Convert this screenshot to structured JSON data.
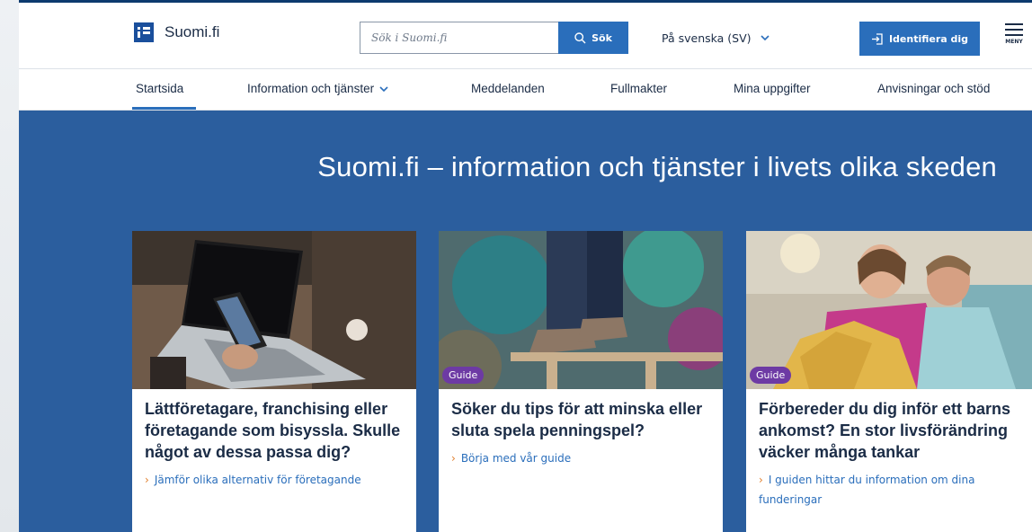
{
  "header": {
    "logo_text": "Suomi.fi",
    "search_placeholder": "Sök i Suomi.fi",
    "search_button": "Sök",
    "language": "På svenska (SV)",
    "identify_button": "Identifiera dig",
    "menu_label": "MENY"
  },
  "nav": {
    "items": [
      {
        "label": "Startsida",
        "active": true
      },
      {
        "label": "Information och tjänster",
        "has_dropdown": true
      },
      {
        "label": "Meddelanden"
      },
      {
        "label": "Fullmakter"
      },
      {
        "label": "Mina uppgifter"
      },
      {
        "label": "Anvisningar och stöd"
      }
    ]
  },
  "hero": {
    "title": "Suomi.fi – information och tjänster i livets olika skeden"
  },
  "cards": [
    {
      "badge": "",
      "title": "Lättföretagare, franchising eller företagande som bisyssla. Skulle något av dessa passa dig?",
      "link": "Jämför olika alternativ för företagande",
      "image": "laptop-phone-photo"
    },
    {
      "badge": "Guide",
      "title": "Söker du tips för att minska eller sluta spela penningspel?",
      "link": "Börja med vår guide",
      "image": "feet-on-railing-photo"
    },
    {
      "badge": "Guide",
      "title": "Förbereder du dig inför ett barns ankomst? En stor livsförändring väcker många tankar",
      "link": "I guiden hittar du information om dina funderingar",
      "image": "couple-on-sofa-photo"
    }
  ],
  "colors": {
    "brand_blue": "#2a6ebb",
    "hero_blue": "#2b5e9e",
    "text_dark": "#1b2c46",
    "guide_purple": "#6d3aa4",
    "link_chevron": "#e07d2a"
  }
}
